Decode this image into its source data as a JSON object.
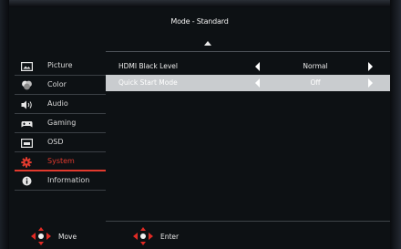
{
  "header": {
    "title": "Mode - Standard"
  },
  "sidebar": {
    "items": [
      {
        "label": "Picture",
        "icon": "picture-icon"
      },
      {
        "label": "Color",
        "icon": "color-icon"
      },
      {
        "label": "Audio",
        "icon": "audio-icon"
      },
      {
        "label": "Gaming",
        "icon": "gaming-icon"
      },
      {
        "label": "OSD",
        "icon": "osd-icon"
      },
      {
        "label": "System",
        "icon": "system-gear-icon",
        "active": true
      },
      {
        "label": "Information",
        "icon": "information-icon"
      }
    ]
  },
  "settings": [
    {
      "name": "HDMI Black Level",
      "value": "Normal"
    },
    {
      "name": "Quick Start Mode",
      "value": "Off",
      "selected": true
    }
  ],
  "footer": {
    "move_label": "Move",
    "enter_label": "Enter"
  },
  "colors": {
    "accent": "#e23a2e",
    "selected_row": "#c9cccf",
    "background": "#0d1114"
  }
}
